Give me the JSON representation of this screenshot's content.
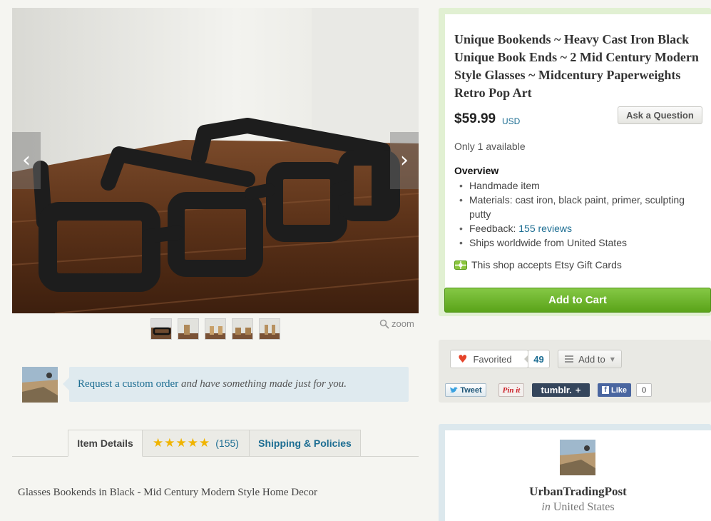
{
  "gallery": {
    "prev_arrow": "‹",
    "next_arrow": "›",
    "thumbnail_count": 5,
    "zoom_label": "zoom"
  },
  "custom_order": {
    "link_text": "Request a custom order",
    "rest_text": " and have something made just for you."
  },
  "tabs": {
    "item_details": "Item Details",
    "stars": "★★★★★",
    "rating": 5,
    "reviews_count": "(155)",
    "shipping": "Shipping & Policies"
  },
  "description": "Glasses Bookends in Black - Mid Century Modern Style Home Decor",
  "listing": {
    "title": "Unique Bookends ~ Heavy Cast Iron Black Unique Book Ends ~ 2 Mid Century Modern Style Glasses ~ Midcentury Paperweights Retro Pop Art",
    "price": "$59.99",
    "currency": "USD",
    "ask_button": "Ask a Question",
    "availability": "Only 1 available",
    "overview_heading": "Overview",
    "overview": {
      "handmade": "Handmade item",
      "materials": "Materials: cast iron, black paint, primer, sculpting putty",
      "feedback_label": "Feedback: ",
      "feedback_link": "155 reviews",
      "ships": "Ships worldwide from United States"
    },
    "giftcard_text": "This shop accepts Etsy Gift Cards",
    "add_to_cart": "Add to Cart"
  },
  "social": {
    "favorited_label": "Favorited",
    "favorites_count": "49",
    "add_to_label": "Add to",
    "tweet": "Tweet",
    "pinit": "Pin it",
    "tumblr": "tumblr.",
    "tumblr_plus": "+",
    "fb_f": "f",
    "fb_like": "Like",
    "fb_count": "0"
  },
  "shop": {
    "name": "UrbanTradingPost",
    "location_prefix": "in",
    "location": "United States"
  },
  "colors": {
    "link": "#1c6d92",
    "cart_green": "#6bb52c",
    "heart_red": "#e5432a",
    "star_gold": "#f0b400"
  }
}
